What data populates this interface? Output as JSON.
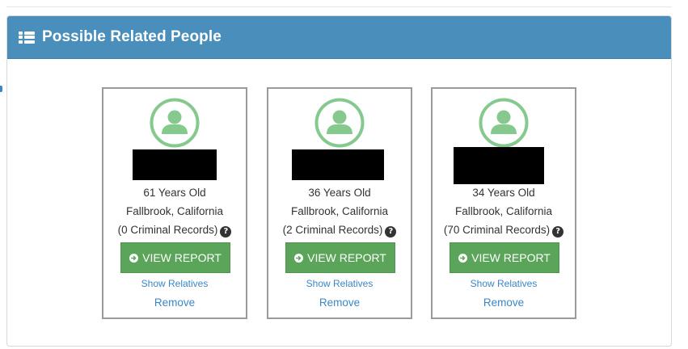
{
  "panel": {
    "title": "Possible Related People"
  },
  "colors": {
    "header_bg": "#4a8ebc",
    "avatar": "#86c98f",
    "button": "#5aa55a",
    "link": "#3a86c8"
  },
  "icons": {
    "header": "list-icon",
    "avatar": "user-circle-icon",
    "button": "arrow-circle-right-icon",
    "help": "question-circle-icon"
  },
  "cards": [
    {
      "age": "61 Years Old",
      "location": "Fallbrook, California",
      "records": "(0 Criminal Records)",
      "view_label": "VIEW REPORT",
      "show_relatives": "Show Relatives",
      "remove": "Remove"
    },
    {
      "age": "36 Years Old",
      "location": "Fallbrook, California",
      "records": "(2 Criminal Records)",
      "view_label": "VIEW REPORT",
      "show_relatives": "Show Relatives",
      "remove": "Remove"
    },
    {
      "age": "34 Years Old",
      "location": "Fallbrook, California",
      "records": "(70 Criminal Records)",
      "view_label": "VIEW REPORT",
      "show_relatives": "Show Relatives",
      "remove": "Remove"
    }
  ],
  "help_glyph": "?"
}
